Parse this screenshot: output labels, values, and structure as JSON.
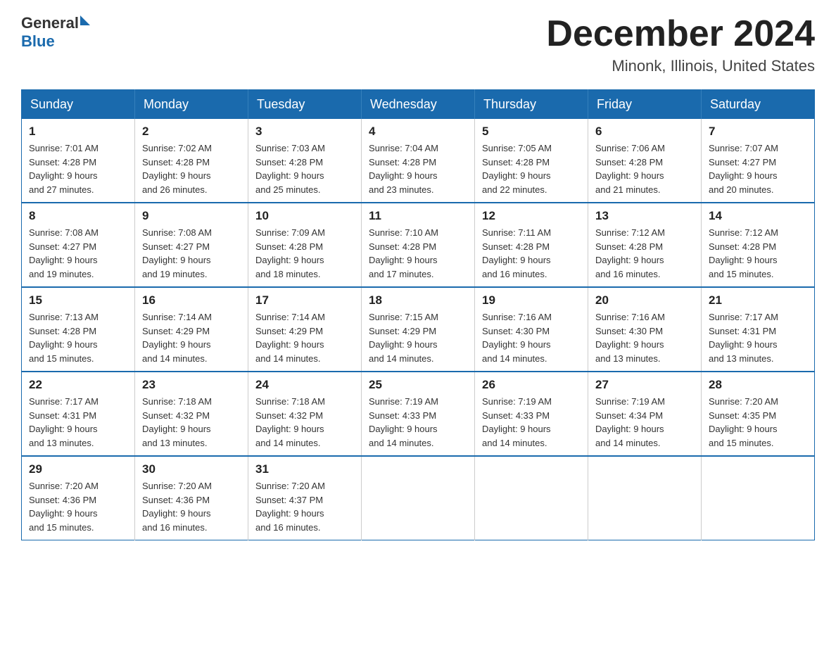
{
  "logo": {
    "general": "General",
    "blue": "Blue"
  },
  "header": {
    "month": "December 2024",
    "location": "Minonk, Illinois, United States"
  },
  "weekdays": [
    "Sunday",
    "Monday",
    "Tuesday",
    "Wednesday",
    "Thursday",
    "Friday",
    "Saturday"
  ],
  "weeks": [
    [
      {
        "day": "1",
        "sunrise": "7:01 AM",
        "sunset": "4:28 PM",
        "daylight": "9 hours and 27 minutes."
      },
      {
        "day": "2",
        "sunrise": "7:02 AM",
        "sunset": "4:28 PM",
        "daylight": "9 hours and 26 minutes."
      },
      {
        "day": "3",
        "sunrise": "7:03 AM",
        "sunset": "4:28 PM",
        "daylight": "9 hours and 25 minutes."
      },
      {
        "day": "4",
        "sunrise": "7:04 AM",
        "sunset": "4:28 PM",
        "daylight": "9 hours and 23 minutes."
      },
      {
        "day": "5",
        "sunrise": "7:05 AM",
        "sunset": "4:28 PM",
        "daylight": "9 hours and 22 minutes."
      },
      {
        "day": "6",
        "sunrise": "7:06 AM",
        "sunset": "4:28 PM",
        "daylight": "9 hours and 21 minutes."
      },
      {
        "day": "7",
        "sunrise": "7:07 AM",
        "sunset": "4:27 PM",
        "daylight": "9 hours and 20 minutes."
      }
    ],
    [
      {
        "day": "8",
        "sunrise": "7:08 AM",
        "sunset": "4:27 PM",
        "daylight": "9 hours and 19 minutes."
      },
      {
        "day": "9",
        "sunrise": "7:08 AM",
        "sunset": "4:27 PM",
        "daylight": "9 hours and 19 minutes."
      },
      {
        "day": "10",
        "sunrise": "7:09 AM",
        "sunset": "4:28 PM",
        "daylight": "9 hours and 18 minutes."
      },
      {
        "day": "11",
        "sunrise": "7:10 AM",
        "sunset": "4:28 PM",
        "daylight": "9 hours and 17 minutes."
      },
      {
        "day": "12",
        "sunrise": "7:11 AM",
        "sunset": "4:28 PM",
        "daylight": "9 hours and 16 minutes."
      },
      {
        "day": "13",
        "sunrise": "7:12 AM",
        "sunset": "4:28 PM",
        "daylight": "9 hours and 16 minutes."
      },
      {
        "day": "14",
        "sunrise": "7:12 AM",
        "sunset": "4:28 PM",
        "daylight": "9 hours and 15 minutes."
      }
    ],
    [
      {
        "day": "15",
        "sunrise": "7:13 AM",
        "sunset": "4:28 PM",
        "daylight": "9 hours and 15 minutes."
      },
      {
        "day": "16",
        "sunrise": "7:14 AM",
        "sunset": "4:29 PM",
        "daylight": "9 hours and 14 minutes."
      },
      {
        "day": "17",
        "sunrise": "7:14 AM",
        "sunset": "4:29 PM",
        "daylight": "9 hours and 14 minutes."
      },
      {
        "day": "18",
        "sunrise": "7:15 AM",
        "sunset": "4:29 PM",
        "daylight": "9 hours and 14 minutes."
      },
      {
        "day": "19",
        "sunrise": "7:16 AM",
        "sunset": "4:30 PM",
        "daylight": "9 hours and 14 minutes."
      },
      {
        "day": "20",
        "sunrise": "7:16 AM",
        "sunset": "4:30 PM",
        "daylight": "9 hours and 13 minutes."
      },
      {
        "day": "21",
        "sunrise": "7:17 AM",
        "sunset": "4:31 PM",
        "daylight": "9 hours and 13 minutes."
      }
    ],
    [
      {
        "day": "22",
        "sunrise": "7:17 AM",
        "sunset": "4:31 PM",
        "daylight": "9 hours and 13 minutes."
      },
      {
        "day": "23",
        "sunrise": "7:18 AM",
        "sunset": "4:32 PM",
        "daylight": "9 hours and 13 minutes."
      },
      {
        "day": "24",
        "sunrise": "7:18 AM",
        "sunset": "4:32 PM",
        "daylight": "9 hours and 14 minutes."
      },
      {
        "day": "25",
        "sunrise": "7:19 AM",
        "sunset": "4:33 PM",
        "daylight": "9 hours and 14 minutes."
      },
      {
        "day": "26",
        "sunrise": "7:19 AM",
        "sunset": "4:33 PM",
        "daylight": "9 hours and 14 minutes."
      },
      {
        "day": "27",
        "sunrise": "7:19 AM",
        "sunset": "4:34 PM",
        "daylight": "9 hours and 14 minutes."
      },
      {
        "day": "28",
        "sunrise": "7:20 AM",
        "sunset": "4:35 PM",
        "daylight": "9 hours and 15 minutes."
      }
    ],
    [
      {
        "day": "29",
        "sunrise": "7:20 AM",
        "sunset": "4:36 PM",
        "daylight": "9 hours and 15 minutes."
      },
      {
        "day": "30",
        "sunrise": "7:20 AM",
        "sunset": "4:36 PM",
        "daylight": "9 hours and 16 minutes."
      },
      {
        "day": "31",
        "sunrise": "7:20 AM",
        "sunset": "4:37 PM",
        "daylight": "9 hours and 16 minutes."
      },
      null,
      null,
      null,
      null
    ]
  ],
  "labels": {
    "sunrise": "Sunrise:",
    "sunset": "Sunset:",
    "daylight": "Daylight:"
  }
}
